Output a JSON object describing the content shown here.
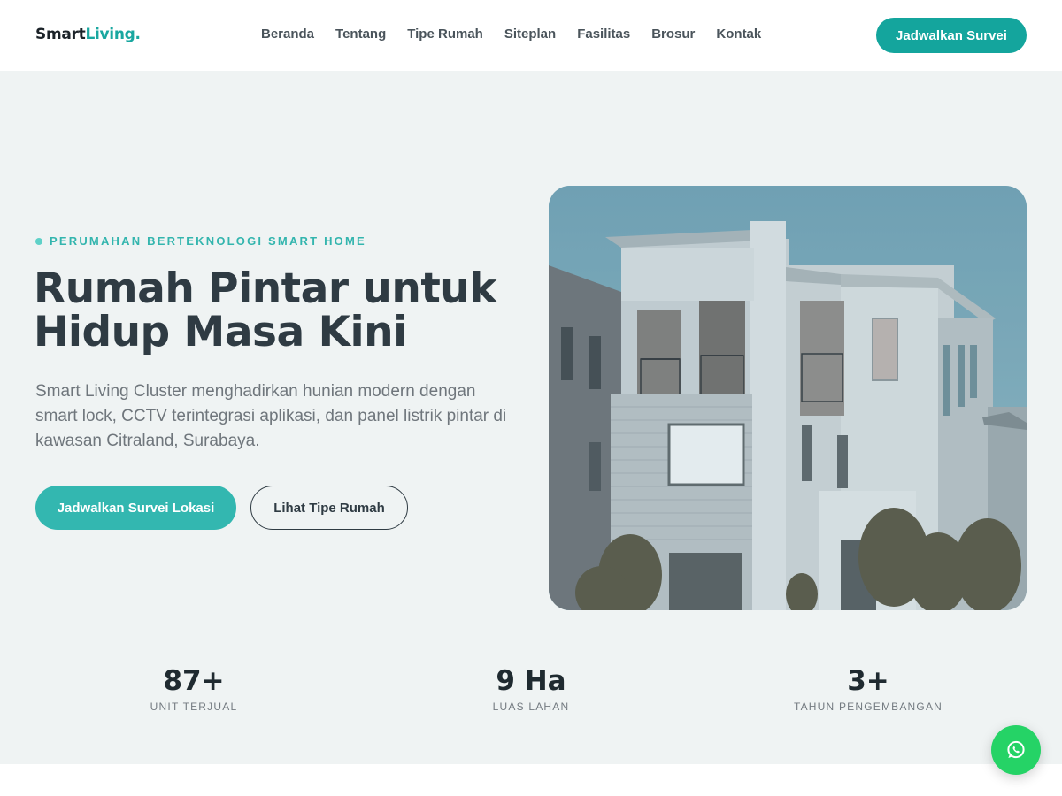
{
  "header": {
    "logo_part1": "Smart",
    "logo_part2": "Living.",
    "nav": [
      "Beranda",
      "Tentang",
      "Tipe Rumah",
      "Siteplan",
      "Fasilitas",
      "Brosur",
      "Kontak"
    ],
    "cta_label": "Jadwalkan Survei"
  },
  "hero": {
    "eyebrow": "PERUMAHAN BERTEKNOLOGI SMART HOME",
    "title_line1": "Rumah Pintar untuk",
    "title_line2": "Hidup Masa Kini",
    "description": "Smart Living Cluster menghadirkan hunian modern dengan smart lock, CCTV terintegrasi aplikasi, dan panel listrik pintar di kawasan Citraland, Surabaya.",
    "primary_button": "Jadwalkan Survei Lokasi",
    "secondary_button": "Lihat Tipe Rumah"
  },
  "stats": [
    {
      "value": "87+",
      "label": "UNIT TERJUAL"
    },
    {
      "value": "9 Ha",
      "label": "LUAS LAHAN"
    },
    {
      "value": "3+",
      "label": "TAHUN PENGEMBANGAN"
    }
  ],
  "icons": {
    "floating_button": "whatsapp-icon",
    "eyebrow_marker": "dot-icon"
  },
  "colors": {
    "brand_teal": "#14a59d",
    "accent_teal": "#33b7b0",
    "whatsapp_green": "#25d366",
    "hero_background": "#eff3f3"
  }
}
